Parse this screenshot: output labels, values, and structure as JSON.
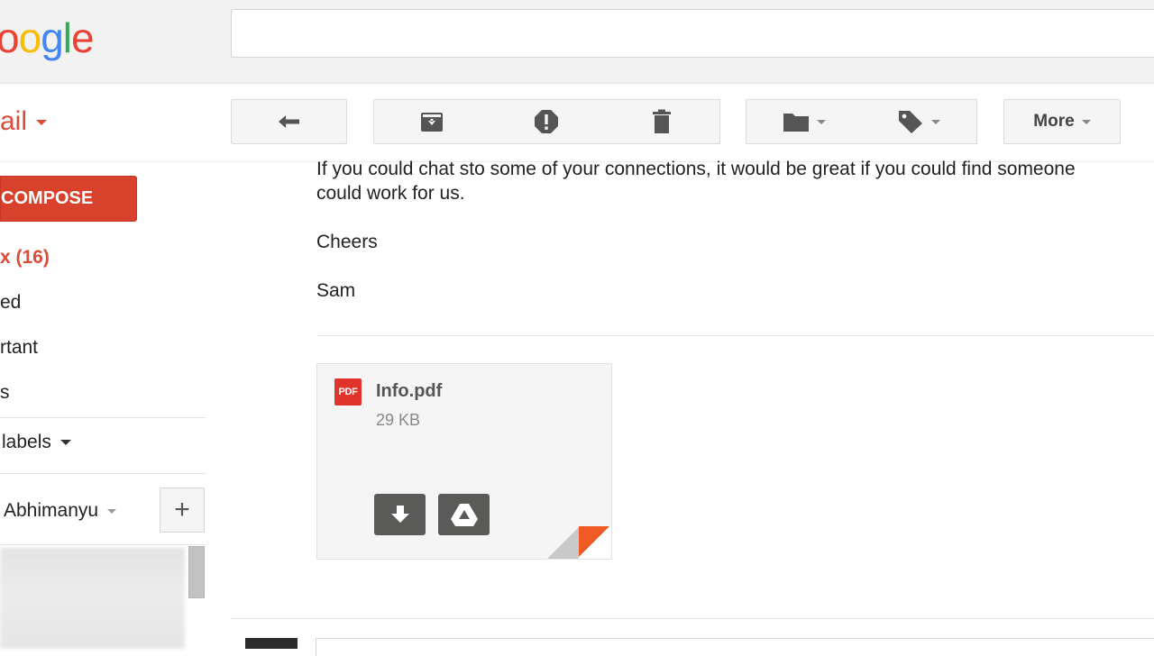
{
  "logo": {
    "text_visible": "oogle",
    "letters": [
      "o",
      "o",
      "g",
      "l",
      "e"
    ],
    "colors": [
      "#ea4335",
      "#fbbc05",
      "#4285f4",
      "#34a853",
      "#ea4335"
    ]
  },
  "search": {
    "value": "",
    "placeholder": ""
  },
  "app_menu": {
    "label": "ail"
  },
  "toolbar": {
    "reply_icon": "reply-icon",
    "archive_icon": "archive-icon",
    "spam_icon": "report-spam-icon",
    "delete_icon": "trash-icon",
    "move_icon": "folder-icon",
    "labels_icon": "tag-icon",
    "more_label": "More"
  },
  "nav": {
    "compose_label": "COMPOSE",
    "items": [
      {
        "label": "x (16)",
        "active": true
      },
      {
        "label": "ed",
        "active": false
      },
      {
        "label": "rtant",
        "active": false
      },
      {
        "label": "s",
        "active": false
      }
    ],
    "more_labels": "labels",
    "hangouts_user": "Abhimanyu",
    "add_label": "+"
  },
  "message": {
    "lines": [
      "If you could chat sto some of your connections, it would be great if you could find someone",
      "could work for us.",
      "Cheers",
      "Sam"
    ]
  },
  "attachment": {
    "type_badge": "PDF",
    "file_name": "Info.pdf",
    "file_size": "29 KB",
    "download_icon": "download-icon",
    "drive_icon": "google-drive-icon"
  },
  "colors": {
    "accent_red": "#dd4b39",
    "compose_bg": "#d8412c",
    "pdf_red": "#e0332c",
    "fold_orange": "#f05a24"
  }
}
